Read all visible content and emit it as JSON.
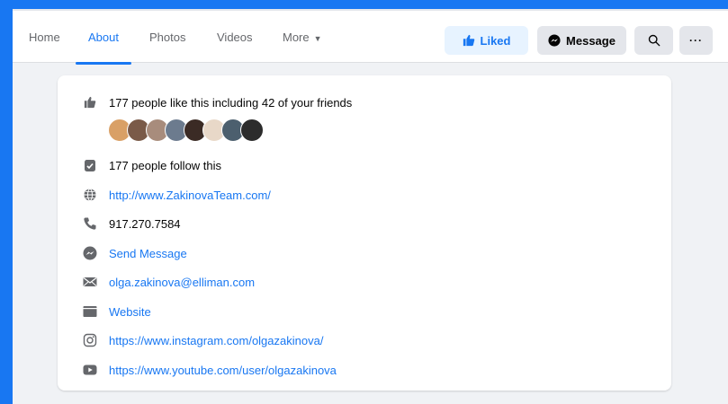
{
  "nav": {
    "tabs": [
      {
        "label": "Home"
      },
      {
        "label": "About"
      },
      {
        "label": "Photos"
      },
      {
        "label": "Videos"
      },
      {
        "label": "More"
      }
    ],
    "active_tab": "About"
  },
  "actions": {
    "liked_label": "Liked",
    "message_label": "Message",
    "search_icon": "search-icon",
    "more_icon": "ellipsis-icon"
  },
  "about": {
    "likes_text": "177 people like this including 42 of your friends",
    "friend_avatars": [
      {
        "color": "#d9a066"
      },
      {
        "color": "#7a5a48"
      },
      {
        "color": "#a88c7c"
      },
      {
        "color": "#6c7b8e"
      },
      {
        "color": "#3b2b25"
      },
      {
        "color": "#e8d8c8"
      },
      {
        "color": "#4c5f6e"
      },
      {
        "color": "#2c2c2c"
      }
    ],
    "follow_text": "177 people follow this",
    "website_url": "http://www.ZakinovaTeam.com/",
    "phone": "917.270.7584",
    "send_message": "Send Message",
    "email": "olga.zakinova@elliman.com",
    "website_label": "Website",
    "instagram": "https://www.instagram.com/olgazakinova/",
    "youtube": "https://www.youtube.com/user/olgazakinova"
  },
  "colors": {
    "accent": "#1877f2",
    "icon_gray": "#65676b",
    "background": "#f0f2f5"
  }
}
